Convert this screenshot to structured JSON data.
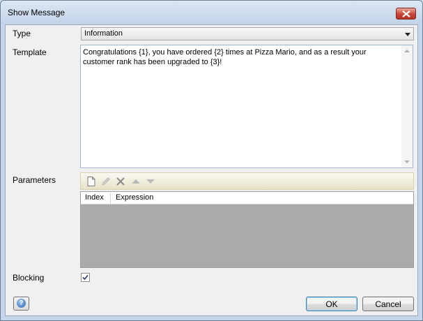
{
  "window": {
    "title": "Show Message"
  },
  "form": {
    "type_label": "Type",
    "type_value": "Information",
    "template_label": "Template",
    "template_text": "Congratulations {1}, you have ordered {2} times at Pizza Mario, and as a result your customer rank has been upgraded to {3}!",
    "parameters_label": "Parameters",
    "blocking_label": "Blocking",
    "blocking_checked": true
  },
  "parameters_table": {
    "columns": [
      "Index",
      "Expression"
    ],
    "rows": []
  },
  "toolbar_icons": [
    "new-icon",
    "edit-icon",
    "delete-icon",
    "move-up-icon",
    "move-down-icon"
  ],
  "buttons": {
    "ok_label": "OK",
    "cancel_label": "Cancel"
  },
  "colors": {
    "toolbar_bg": "#ece8d0",
    "grid_bg": "#ababab",
    "accent": "#3c7fb1"
  }
}
